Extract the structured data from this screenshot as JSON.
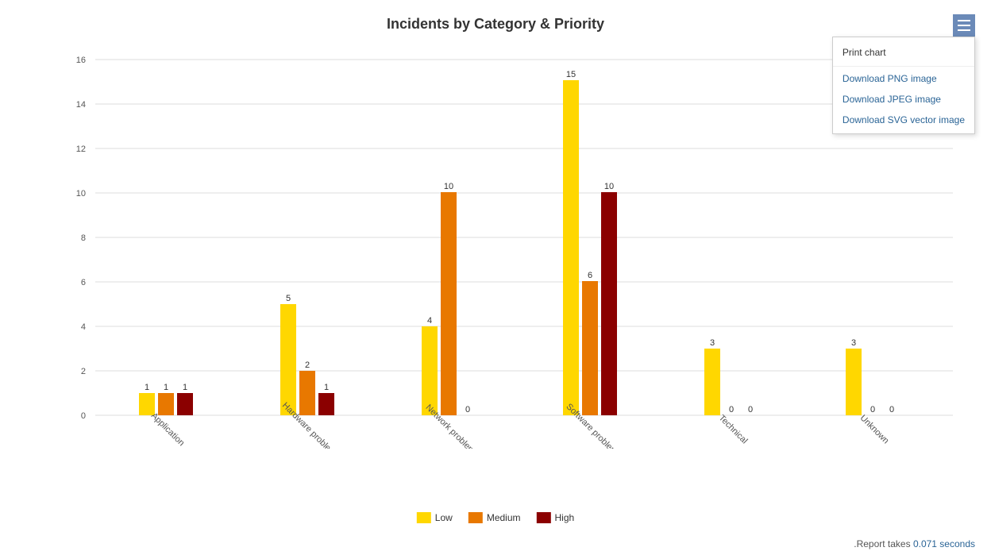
{
  "title": "Incidents by Category & Priority",
  "menu": {
    "button_label": "≡",
    "print": "Print chart",
    "download_png": "Download PNG image",
    "download_jpeg": "Download JPEG image",
    "download_svg": "Download SVG vector image"
  },
  "legend": {
    "items": [
      {
        "label": "Low",
        "color": "#FFD700"
      },
      {
        "label": "Medium",
        "color": "#E87800"
      },
      {
        "label": "High",
        "color": "#8B0000"
      }
    ]
  },
  "chart": {
    "y_max": 16,
    "y_ticks": [
      0,
      2,
      4,
      6,
      8,
      10,
      12,
      14,
      16
    ],
    "categories": [
      {
        "name": "Application",
        "low": 1,
        "medium": 1,
        "high": 1
      },
      {
        "name": "Hardware problem",
        "low": 5,
        "medium": 2,
        "high": 1
      },
      {
        "name": "Network problem",
        "low": 4,
        "medium": 10,
        "high": 0
      },
      {
        "name": "Software problem",
        "low": 15,
        "medium": 6,
        "high": 10
      },
      {
        "name": "Technical",
        "low": 3,
        "medium": 0,
        "high": 0
      },
      {
        "name": "Unknown",
        "low": 3,
        "medium": 0,
        "high": 0
      }
    ]
  },
  "footer": {
    "text": ".Report takes ",
    "duration": "0.071 seconds"
  }
}
